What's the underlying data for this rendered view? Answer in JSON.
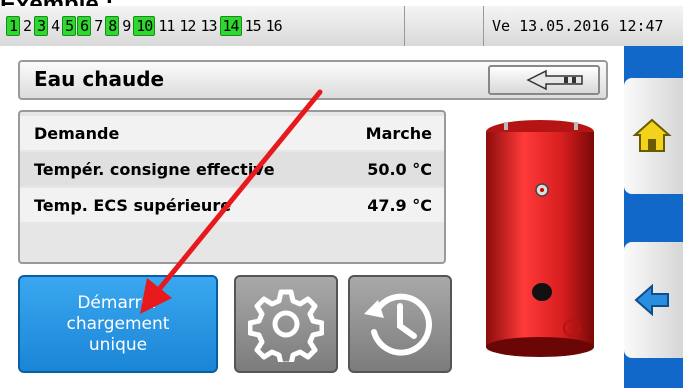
{
  "caption": "Exemple :",
  "status_bar": {
    "outputs": [
      {
        "label": "1",
        "active": true
      },
      {
        "label": "2",
        "active": false
      },
      {
        "label": "3",
        "active": true
      },
      {
        "label": "4",
        "active": false
      },
      {
        "label": "5",
        "active": true
      },
      {
        "label": "6",
        "active": true
      },
      {
        "label": "7",
        "active": false
      },
      {
        "label": "8",
        "active": true
      },
      {
        "label": "9",
        "active": false
      },
      {
        "label": "10",
        "active": true
      },
      {
        "label": "11",
        "active": false
      },
      {
        "label": "12",
        "active": false
      },
      {
        "label": "13",
        "active": false
      },
      {
        "label": "14",
        "active": true
      },
      {
        "label": "15",
        "active": false
      },
      {
        "label": "16",
        "active": false
      }
    ],
    "datetime": "Ve 13.05.2016 12:47"
  },
  "page": {
    "title": "Eau chaude"
  },
  "info_rows": [
    {
      "label": "Demande",
      "value": "Marche"
    },
    {
      "label": "Tempér. consigne effective",
      "value": "50.0 °C"
    },
    {
      "label": "Temp. ECS supérieure",
      "value": "47.9 °C"
    }
  ],
  "actions": {
    "charge_label": "Démarrer\nchargement\nunique"
  },
  "icons": {
    "back": "back-arrow-icon",
    "settings": "gear-icon",
    "history": "history-clock-icon",
    "home": "home-icon",
    "nav_back": "arrow-left-icon",
    "boiler": "water-heater-icon"
  },
  "colors": {
    "accent_blue": "#1b85d6",
    "active_output": "#2ed82e",
    "tank_red": "#d81e1e",
    "annotation_arrow": "#e8191c"
  }
}
